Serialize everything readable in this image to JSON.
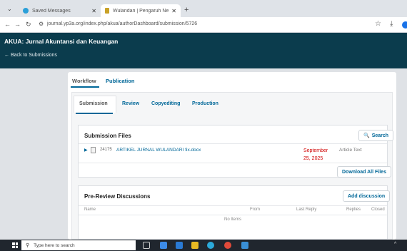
{
  "browser": {
    "tabs": [
      {
        "title": "Saved Messages",
        "icon": "telegram-icon",
        "active": false
      },
      {
        "title": "Wulandari | Pengaruh Net Profi",
        "icon": "journal-favicon-icon",
        "active": true
      }
    ],
    "new_tab_label": "+",
    "url": "journal.yp3a.org/index.php/akua/authorDashboard/submission/5726"
  },
  "header": {
    "journal_title": "AKUA: Jurnal Akuntansi dan Keuangan",
    "back_label": "Back to Submissions"
  },
  "top_tabs": [
    "Workflow",
    "Publication"
  ],
  "stage_tabs": [
    "Submission",
    "Review",
    "Copyediting",
    "Production"
  ],
  "submission_files": {
    "title": "Submission Files",
    "search_label": "Search",
    "file": {
      "id": "24175",
      "name": "ARTIKEL JURNAL WULANDARI fix.docx",
      "date": "September 25, 2025",
      "type": "Article Text"
    },
    "download_all_label": "Download All Files"
  },
  "discussions": {
    "title": "Pre-Review Discussions",
    "add_label": "Add discussion",
    "columns": [
      "Name",
      "From",
      "Last Reply",
      "Replies",
      "Closed"
    ],
    "empty_text": "No Items"
  },
  "taskbar": {
    "search_placeholder": "Type here to search"
  },
  "colors": {
    "header_bg": "#0b3c4d",
    "link": "#006798",
    "date_red": "#d00000"
  }
}
